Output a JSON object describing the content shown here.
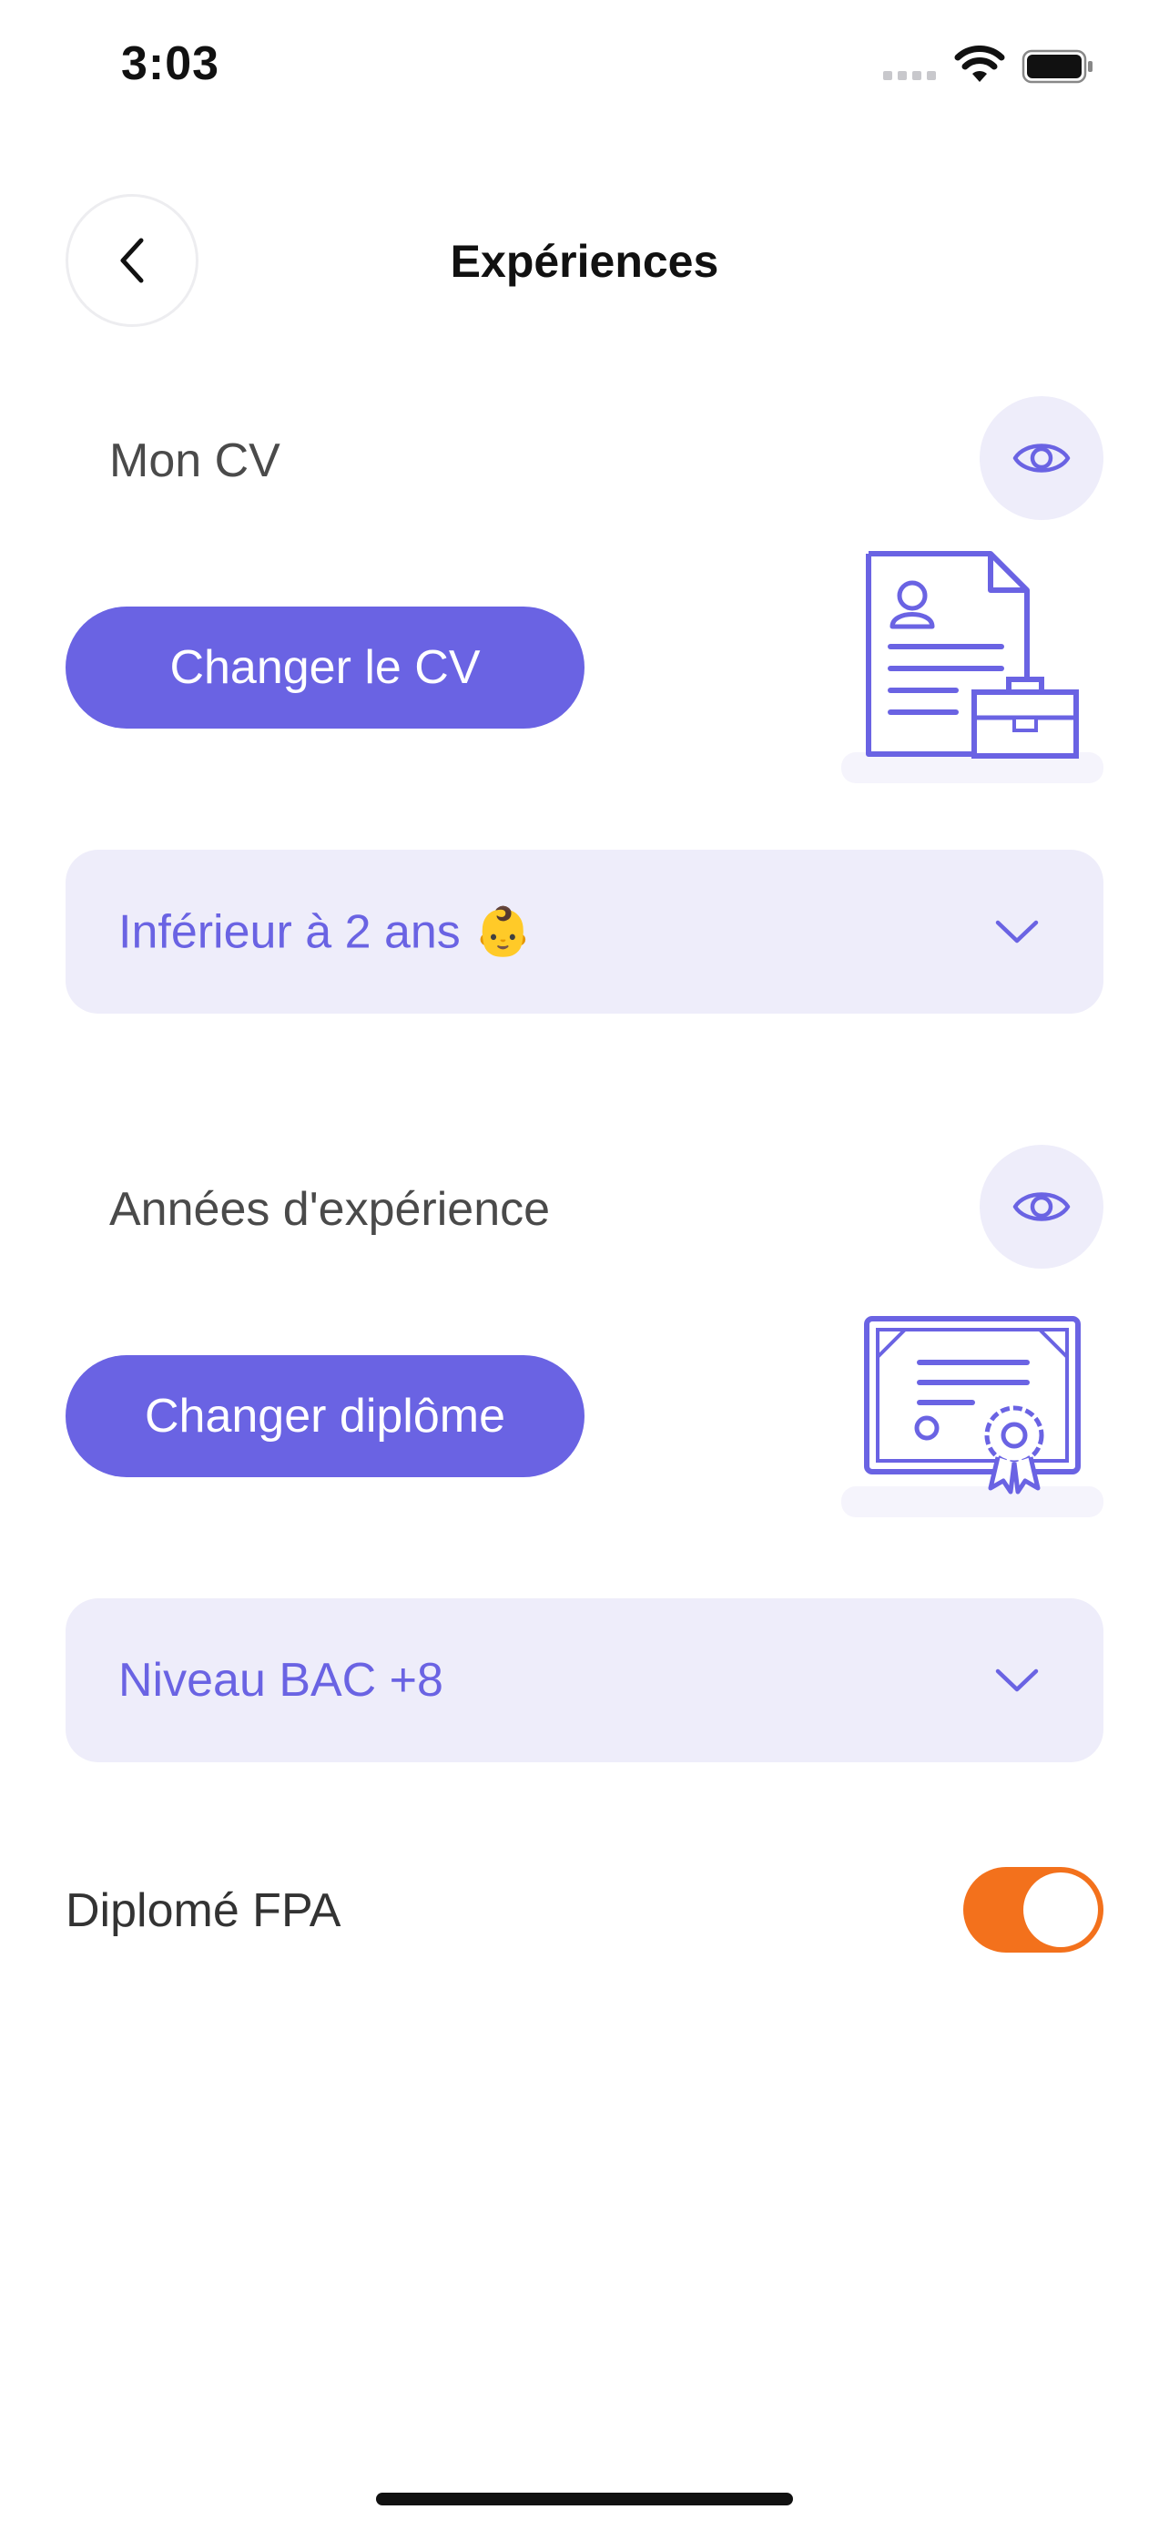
{
  "status_bar": {
    "time": "3:03"
  },
  "header": {
    "title": "Expériences"
  },
  "cv_section": {
    "label": "Mon CV",
    "change_button": "Changer le CV",
    "experience_dropdown": {
      "value": "Inférieur à 2 ans 👶"
    }
  },
  "diploma_section": {
    "label": "Années d'expérience",
    "change_button": "Changer diplôme",
    "level_dropdown": {
      "value": "Niveau BAC +8"
    }
  },
  "fpa": {
    "label": "Diplomé FPA",
    "enabled": true
  },
  "colors": {
    "accent": "#6a63e3",
    "accent_light": "#eeedfa",
    "toggle_on": "#f3711c"
  },
  "icons": {
    "back": "chevron-left-icon",
    "view": "eye-icon",
    "dropdown": "chevron-down-icon",
    "cv_illustration": "resume-briefcase-icon",
    "diploma_illustration": "certificate-icon"
  }
}
